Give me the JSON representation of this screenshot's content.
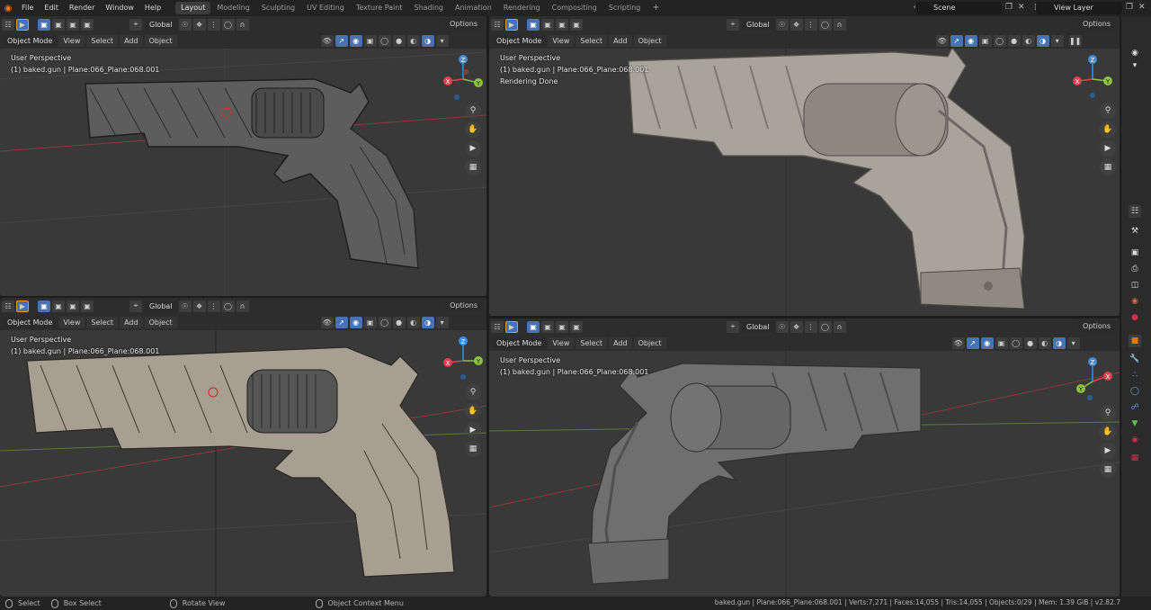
{
  "app": {
    "logo": "blender-logo",
    "menus": [
      "File",
      "Edit",
      "Render",
      "Window",
      "Help"
    ],
    "workspaces": [
      "Layout",
      "Modeling",
      "Sculpting",
      "UV Editing",
      "Texture Paint",
      "Shading",
      "Animation",
      "Rendering",
      "Compositing",
      "Scripting"
    ],
    "active_workspace": "Layout",
    "add_workspace": "+",
    "scene": "Scene",
    "view_layer": "View Layer"
  },
  "viewport_common": {
    "mode": "Object Mode",
    "menus": [
      "View",
      "Select",
      "Add",
      "Object"
    ],
    "transform_orientation": "Global",
    "options": "Options",
    "perspective": "User Perspective"
  },
  "viewports": [
    {
      "id": "top-left",
      "object_info": "(1) baked.gun | Plane:066_Plane:068.001",
      "extra": "",
      "shading": "wireframe"
    },
    {
      "id": "top-right",
      "object_info": "(1) baked.gun | Plane:066_Plane:068.001",
      "extra": "Rendering Done",
      "shading": "rendered"
    },
    {
      "id": "bottom-left",
      "object_info": "(1) baked.gun | Plane:066_Plane:068.001",
      "extra": "",
      "shading": "wireframe-textured"
    },
    {
      "id": "bottom-right",
      "object_info": "(1) baked.gun | Plane:066_Plane:068.001",
      "extra": "",
      "shading": "solid"
    }
  ],
  "gizmo_axes": {
    "x": "X",
    "y": "Y",
    "z": "Z"
  },
  "colors": {
    "accent_orange": "#ea7600",
    "axis_x": "#e0414f",
    "axis_y": "#8bc340",
    "axis_z": "#3b8fe0",
    "active_blue": "#4772b3",
    "viewport_bg": "#393939"
  },
  "statusbar": {
    "select": "Select",
    "box_select": "Box Select",
    "rotate_view": "Rotate View",
    "context_menu": "Object Context Menu",
    "info": "baked.gun | Plane:066_Plane:068.001 | Verts:7,271 | Faces:14,055 | Tris:14,055 | Objects:0/29 | Mem: 1.39 GiB | v2.82.7"
  }
}
